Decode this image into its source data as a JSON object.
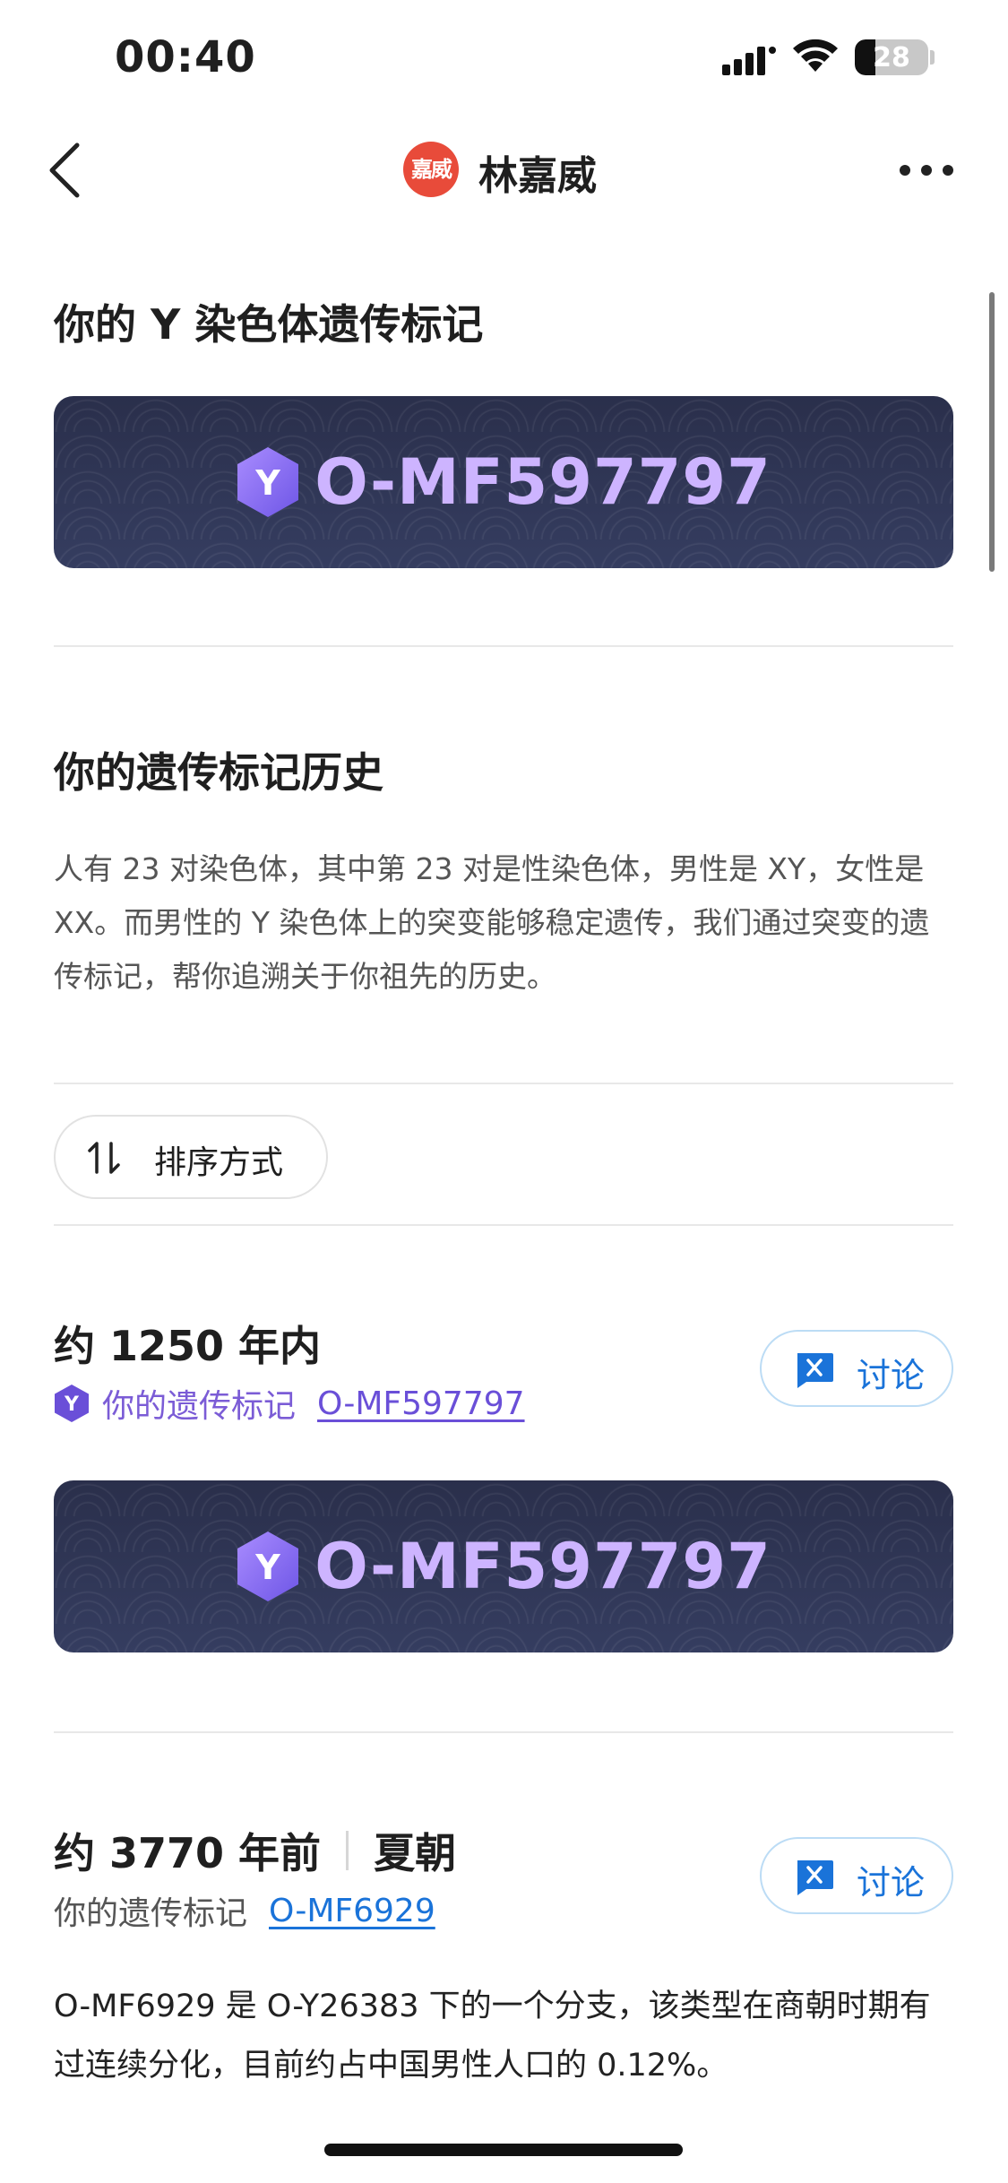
{
  "status_bar": {
    "time": "00:40",
    "battery": "28",
    "battery_level": 0.28
  },
  "nav": {
    "avatar_text": "嘉威",
    "title": "林嘉威"
  },
  "y_section": {
    "title": "你的 Y 染色体遗传标记",
    "banner_badge": "Y",
    "banner_code": "O-MF597797"
  },
  "history": {
    "title": "你的遗传标记历史",
    "description": "人有 23 对染色体，其中第 23 对是性染色体，男性是 XY，女性是 XX。而男性的 Y 染色体上的突变能够稳定遗传，我们通过突变的遗传标记，帮你追溯关于你祖先的历史。"
  },
  "sort": {
    "label": "排序方式"
  },
  "entries": [
    {
      "period": "约 1250 年内",
      "dynasty": "",
      "badge": "Y",
      "marker_label": "你的遗传标记",
      "marker_code": "O-MF597797",
      "discuss_label": "讨论",
      "banner_code": "O-MF597797",
      "description": ""
    },
    {
      "period": "约 3770 年前",
      "dynasty": "夏朝",
      "marker_label": "你的遗传标记",
      "marker_code": "O-MF6929",
      "discuss_label": "讨论",
      "description": "O-MF6929 是 O-Y26383 下的一个分支，该类型在商朝时期有过连续分化，目前约占中国男性人口的 0.12%。"
    }
  ],
  "colors": {
    "accent_blue": "#1a73d9",
    "accent_purple": "#7b5cd6",
    "banner_bg": "#2c3350",
    "banner_text": "#cdb4ff"
  }
}
